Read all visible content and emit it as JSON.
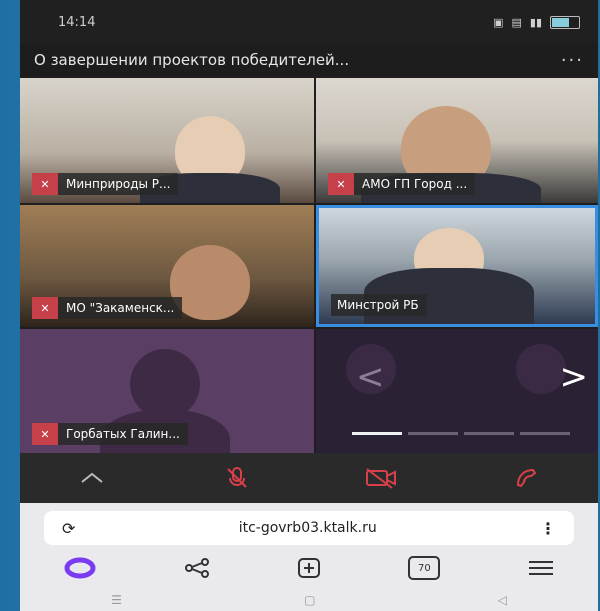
{
  "status": {
    "time": "14:14"
  },
  "header": {
    "title": "О завершении проектов победителей...",
    "more": "···"
  },
  "participants": [
    {
      "name": "Минприроды Р..."
    },
    {
      "name": "АМО ГП Город ..."
    },
    {
      "name": "МО \"Закаменск..."
    },
    {
      "name": "Минстрой РБ",
      "active": true
    },
    {
      "name": "Горбатых Галин..."
    }
  ],
  "carousel": {
    "prev": "<",
    "next": ">",
    "pages": 4,
    "current": 1
  },
  "browser": {
    "url": "itc-govrb03.ktalk.ru",
    "tab_count": "70"
  },
  "colors": {
    "accent": "#3a8ee0",
    "mic_off": "#c6404a",
    "end_call": "#d6404a"
  },
  "icons": [
    "chevron-up-icon",
    "mic-off-icon",
    "camera-off-icon",
    "end-call-icon",
    "reload-icon",
    "kebab-menu-icon",
    "alice-icon",
    "share-icon",
    "new-tab-icon",
    "menu-icon"
  ]
}
